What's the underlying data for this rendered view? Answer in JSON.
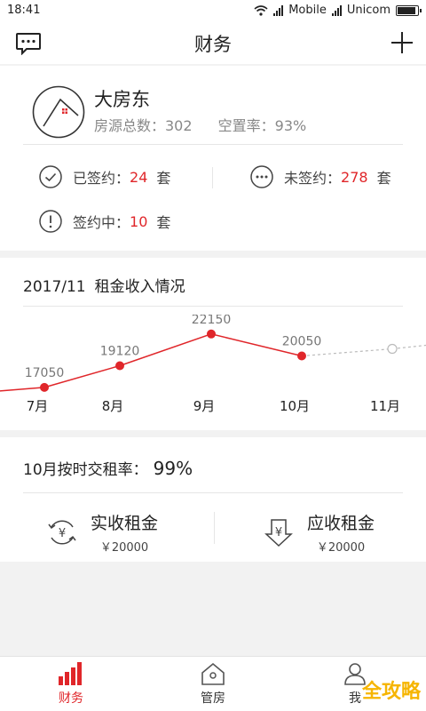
{
  "status": {
    "time": "18:41",
    "carrier1": "Mobile",
    "carrier2": "Unicom"
  },
  "nav": {
    "title": "财务"
  },
  "owner": {
    "name": "大房东",
    "houses_label": "房源总数：302",
    "vacancy_label": "空置率：93%"
  },
  "contracts": {
    "signed_label": "已签约：",
    "signed_count": "24",
    "signed_unit": "套",
    "unsigned_label": "未签约：",
    "unsigned_count": "278",
    "unsigned_unit": "套",
    "signing_label": "签约中：",
    "signing_count": "10",
    "signing_unit": "套"
  },
  "income": {
    "period": "2017/11",
    "title": "租金收入情况"
  },
  "chart_data": {
    "type": "line",
    "categories": [
      "7月",
      "8月",
      "9月",
      "10月",
      "11月"
    ],
    "values": [
      17050,
      19120,
      22150,
      20050,
      null
    ],
    "data_labels": [
      "17050",
      "19120",
      "22150",
      "20050",
      ""
    ],
    "future_point": "11月",
    "colors": {
      "line": "#e0262a",
      "future": "#bbbbbb"
    }
  },
  "ontime": {
    "title": "10月按时交租率：",
    "rate": "99%"
  },
  "rent": {
    "received_label": "实收租金",
    "received_amount": "￥20000",
    "due_label": "应收租金",
    "due_amount": "￥20000"
  },
  "tabs": [
    {
      "label": "财务",
      "icon": "bar-chart-icon",
      "active": true
    },
    {
      "label": "管房",
      "icon": "house-icon",
      "active": false
    },
    {
      "label": "我",
      "icon": "person-icon",
      "active": false
    }
  ],
  "watermark": "全攻略",
  "colors": {
    "accent": "#e0262a",
    "text": "#333333",
    "muted": "#888888"
  }
}
